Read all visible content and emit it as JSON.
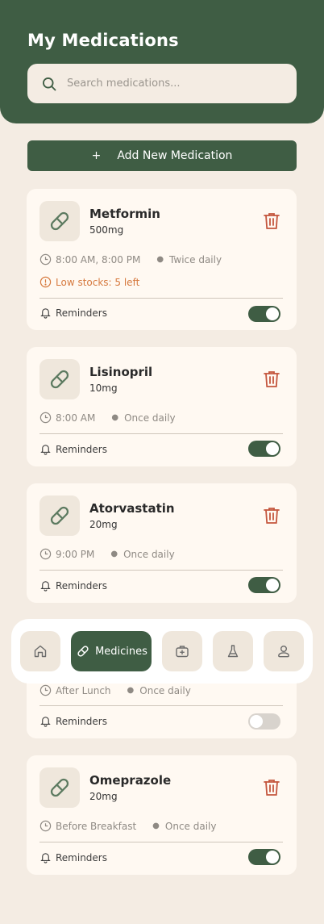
{
  "header": {
    "title": "My Medications"
  },
  "search": {
    "placeholder": "Search medications..."
  },
  "add_button": {
    "plus": "+",
    "label": "Add New Medication"
  },
  "reminders_label": "Reminders",
  "medications": [
    {
      "name": "Metformin",
      "dose": "500mg",
      "time": "8:00 AM, 8:00 PM",
      "frequency": "Twice daily",
      "low_stock": "Low stocks: 5 left",
      "reminders_on": true
    },
    {
      "name": "Lisinopril",
      "dose": "10mg",
      "time": "8:00 AM",
      "frequency": "Once daily",
      "reminders_on": true
    },
    {
      "name": "Atorvastatin",
      "dose": "20mg",
      "time": "9:00 PM",
      "frequency": "Once daily",
      "reminders_on": true
    },
    {
      "name": "",
      "dose": "",
      "time": "After Lunch",
      "frequency": "Once daily",
      "reminders_on": false
    },
    {
      "name": "Omeprazole",
      "dose": "20mg",
      "time": "Before Breakfast",
      "frequency": "Once daily",
      "reminders_on": true
    }
  ],
  "nav": {
    "items": [
      {
        "icon": "home-icon"
      },
      {
        "icon": "pill-icon",
        "label": "Medicines",
        "active": true
      },
      {
        "icon": "medical-kit-icon"
      },
      {
        "icon": "flask-icon"
      },
      {
        "icon": "profile-icon"
      }
    ]
  },
  "colors": {
    "primary": "#3f5d44",
    "background": "#f4ece3",
    "card": "#fff9f2",
    "danger": "#c4553d",
    "warning": "#d6793e"
  }
}
